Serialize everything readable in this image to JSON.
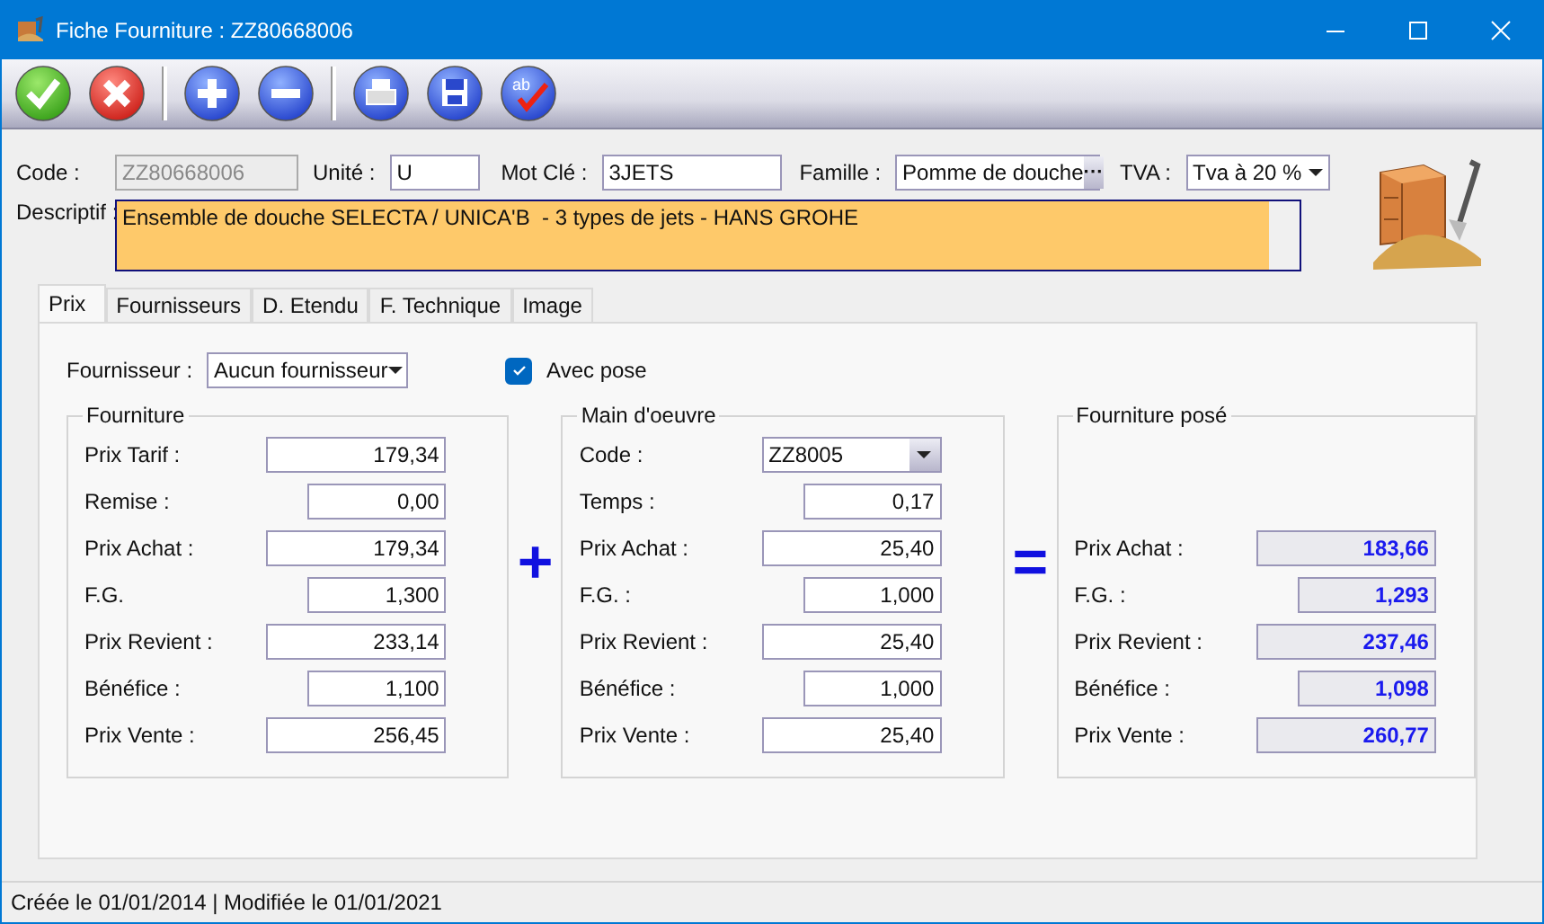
{
  "window": {
    "title": "Fiche Fourniture : ZZ80668006"
  },
  "toolbar": [
    {
      "kind": "ok"
    },
    {
      "kind": "cancel"
    },
    {
      "kind": "separator"
    },
    {
      "kind": "add"
    },
    {
      "kind": "remove"
    },
    {
      "kind": "separator"
    },
    {
      "kind": "print"
    },
    {
      "kind": "save"
    },
    {
      "kind": "spellcheck",
      "text": "ab"
    }
  ],
  "header": {
    "code": {
      "label": "Code :",
      "value": "ZZ80668006",
      "disabled": true
    },
    "unite": {
      "label": "Unité :",
      "value": "U"
    },
    "mot_cle": {
      "label": "Mot Clé :",
      "value": "3JETS"
    },
    "famille": {
      "label": "Famille :",
      "value": "Pomme de douche",
      "button": "···"
    },
    "tva": {
      "label": "TVA :",
      "value": "Tva à 20 %"
    },
    "descriptif": {
      "label": "Descriptif :",
      "value": "Ensemble de douche SELECTA / UNICA'B  - 3 types de jets - HANS GROHE"
    }
  },
  "tabs": [
    {
      "label": "Prix",
      "selected": true
    },
    {
      "label": "Fournisseurs",
      "selected": false
    },
    {
      "label": "D. Etendu",
      "selected": false
    },
    {
      "label": "F. Technique",
      "selected": false
    },
    {
      "label": "Image",
      "selected": false
    }
  ],
  "fournisseur": {
    "label": "Fournisseur :",
    "value": "Aucun fournisseur"
  },
  "avec_pose": {
    "label": "Avec pose",
    "checked": true
  },
  "operators": [
    "+",
    "="
  ],
  "groups": [
    {
      "title": "Fourniture",
      "kind": "input",
      "fields": [
        {
          "label": "Prix Tarif :",
          "value": "179,34",
          "kind": "long"
        },
        {
          "label": "Remise :",
          "value": "0,00",
          "kind": "short"
        },
        {
          "label": "Prix Achat :",
          "value": "179,34",
          "kind": "long"
        },
        {
          "label": "F.G.",
          "value": "1,300",
          "kind": "short"
        },
        {
          "label": "Prix Revient :",
          "value": "233,14",
          "kind": "long"
        },
        {
          "label": "Bénéfice :",
          "value": "1,100",
          "kind": "short"
        },
        {
          "label": "Prix Vente :",
          "value": "256,45",
          "kind": "long"
        }
      ]
    },
    {
      "title": "Main d'oeuvre",
      "kind": "input",
      "fields": [
        {
          "label": "Code :",
          "value": "ZZ8005",
          "kind": "combo"
        },
        {
          "label": "Temps :",
          "value": "0,17",
          "kind": "short"
        },
        {
          "label": "Prix Achat :",
          "value": "25,40",
          "kind": "long"
        },
        {
          "label": "F.G. :",
          "value": "1,000",
          "kind": "short"
        },
        {
          "label": "Prix Revient :",
          "value": "25,40",
          "kind": "long"
        },
        {
          "label": "Bénéfice :",
          "value": "1,000",
          "kind": "short"
        },
        {
          "label": "Prix Vente :",
          "value": "25,40",
          "kind": "long"
        }
      ]
    },
    {
      "title": "Fourniture posé",
      "kind": "result",
      "fields": [
        {
          "label": "Prix Achat :",
          "value": "183,66",
          "kind": "long"
        },
        {
          "label": "F.G. :",
          "value": "1,293",
          "kind": "short"
        },
        {
          "label": "Prix Revient :",
          "value": "237,46",
          "kind": "long"
        },
        {
          "label": "Bénéfice :",
          "value": "1,098",
          "kind": "short"
        },
        {
          "label": "Prix Vente :",
          "value": "260,77",
          "kind": "long"
        }
      ]
    }
  ],
  "status_bar": "Créée le 01/01/2014 | Modifiée le 01/01/2021"
}
